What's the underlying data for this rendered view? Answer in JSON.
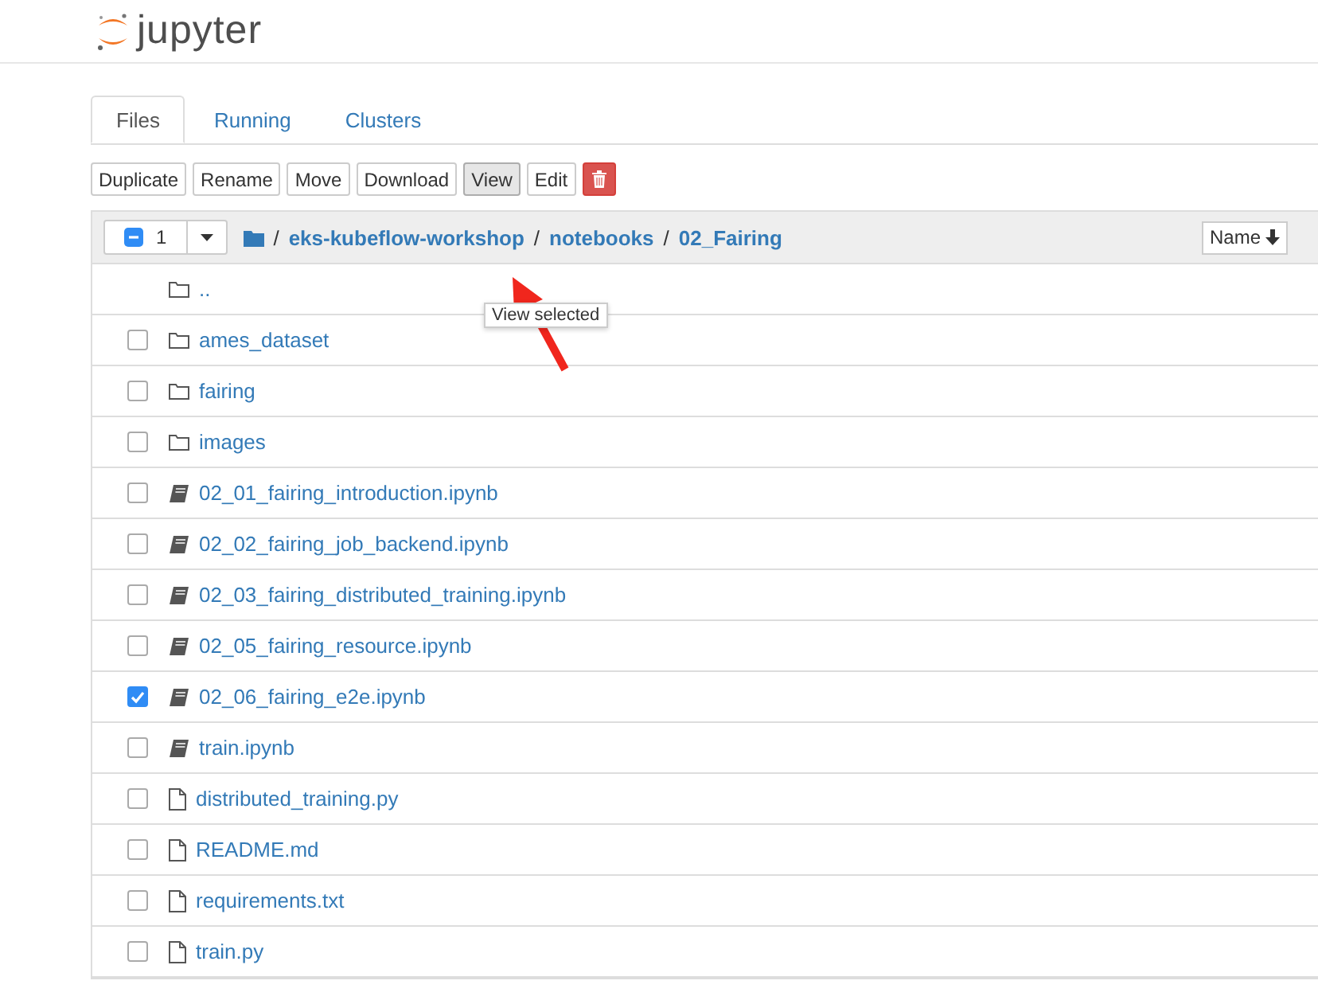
{
  "header": {
    "logo_text": "jupyter"
  },
  "tabs": [
    {
      "label": "Files",
      "selected": true
    },
    {
      "label": "Running",
      "selected": false
    },
    {
      "label": "Clusters",
      "selected": false
    }
  ],
  "toolbar": {
    "buttons": [
      {
        "label": "Duplicate",
        "kind": "text",
        "pressed": false
      },
      {
        "label": "Rename",
        "kind": "text",
        "pressed": false
      },
      {
        "label": "Move",
        "kind": "text",
        "pressed": false
      },
      {
        "label": "Download",
        "kind": "text",
        "pressed": false
      },
      {
        "label": "View",
        "kind": "text",
        "pressed": true
      },
      {
        "label": "Edit",
        "kind": "text",
        "pressed": false
      },
      {
        "kind": "delete"
      }
    ],
    "tooltip": "View selected"
  },
  "list_header": {
    "selected_count": "1",
    "breadcrumb": [
      "/",
      "eks-kubeflow-workshop",
      "/",
      "notebooks",
      "/",
      "02_Fairing"
    ],
    "sort_button": "Name"
  },
  "items": [
    {
      "kind": "parent",
      "name": ".."
    },
    {
      "kind": "folder",
      "name": "ames_dataset",
      "checked": false
    },
    {
      "kind": "folder",
      "name": "fairing",
      "checked": false
    },
    {
      "kind": "folder",
      "name": "images",
      "checked": false
    },
    {
      "kind": "notebook",
      "name": "02_01_fairing_introduction.ipynb",
      "checked": false
    },
    {
      "kind": "notebook",
      "name": "02_02_fairing_job_backend.ipynb",
      "checked": false
    },
    {
      "kind": "notebook",
      "name": "02_03_fairing_distributed_training.ipynb",
      "checked": false
    },
    {
      "kind": "notebook",
      "name": "02_05_fairing_resource.ipynb",
      "checked": false
    },
    {
      "kind": "notebook",
      "name": "02_06_fairing_e2e.ipynb",
      "checked": true
    },
    {
      "kind": "notebook",
      "name": "train.ipynb",
      "checked": false
    },
    {
      "kind": "file",
      "name": "distributed_training.py",
      "checked": false
    },
    {
      "kind": "file",
      "name": "README.md",
      "checked": false
    },
    {
      "kind": "file",
      "name": "requirements.txt",
      "checked": false
    },
    {
      "kind": "file",
      "name": "train.py",
      "checked": false
    }
  ]
}
